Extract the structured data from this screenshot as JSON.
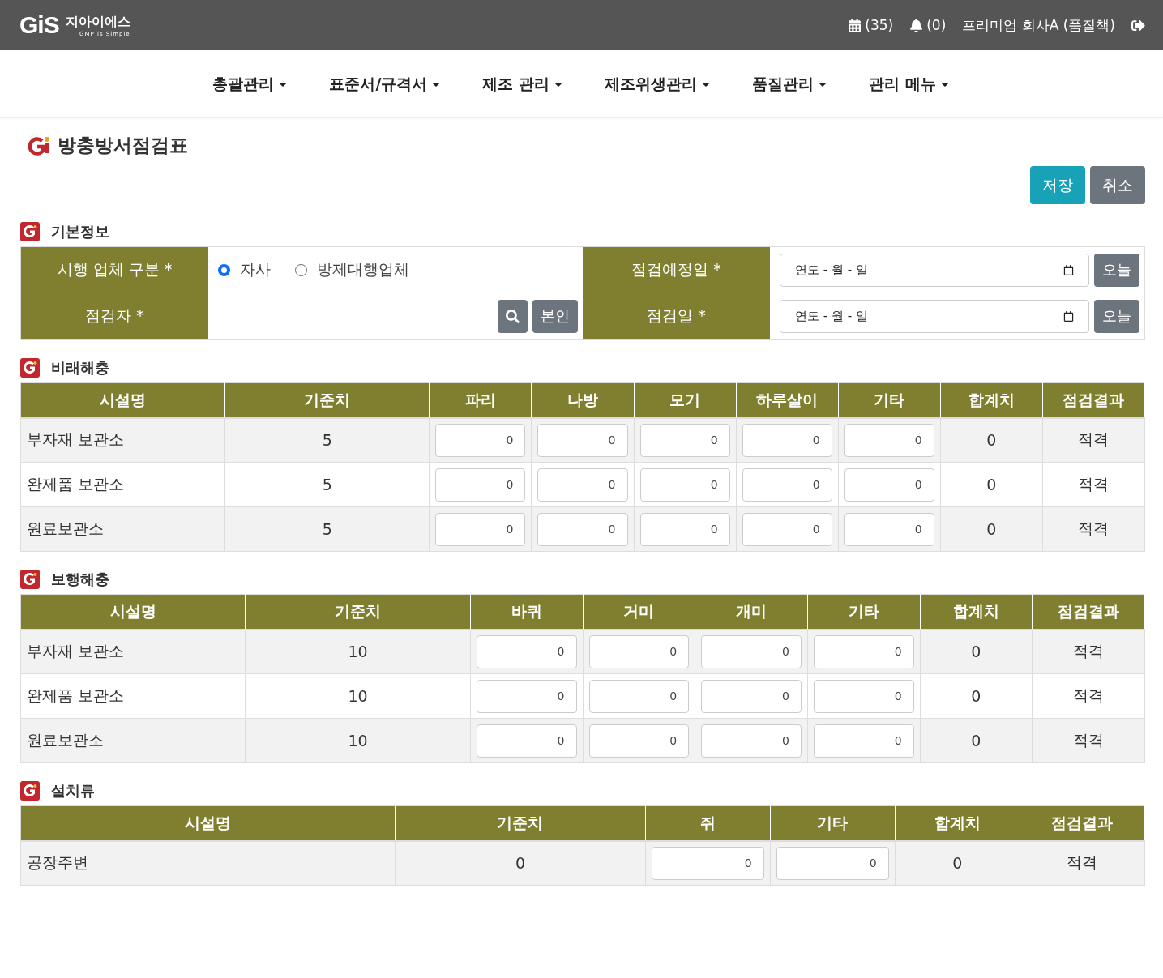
{
  "header": {
    "logo": {
      "mark": "GiS",
      "name": "지아이에스",
      "tagline": "GMP is Simple"
    },
    "calendar_count": "(35)",
    "alerts_count": "(0)",
    "user": "프리미엄 회사A (품질책)"
  },
  "nav": [
    {
      "label": "총괄관리"
    },
    {
      "label": "표준서/규격서"
    },
    {
      "label": "제조 관리"
    },
    {
      "label": "제조위생관리"
    },
    {
      "label": "품질관리"
    },
    {
      "label": "관리 메뉴"
    }
  ],
  "page_title": "방충방서점검표",
  "actions": [
    {
      "label": "저장",
      "kind": "primary"
    },
    {
      "label": "취소",
      "kind": "secondary"
    }
  ],
  "basic_info": {
    "title": "기본정보",
    "vendor_label": "시행 업체 구분 *",
    "vendor_options": [
      {
        "label": "자사",
        "selected": true
      },
      {
        "label": "방제대행업체",
        "selected": false
      }
    ],
    "scheduled_label": "점검예정일 *",
    "scheduled_date": "연도 - 월 - 일",
    "scheduled_today": "오늘",
    "inspector_label": "점검자 *",
    "inspector_self": "본인",
    "date_label": "점검일 *",
    "date_value": "연도 - 월 - 일",
    "date_today": "오늘"
  },
  "sections": [
    {
      "title": "비래해충",
      "columns": [
        "시설명",
        "기준치",
        "파리",
        "나방",
        "모기",
        "하루살이",
        "기타",
        "합계치",
        "점검결과"
      ],
      "rows": [
        {
          "name": "부자재 보관소",
          "standard": "5",
          "values": [
            "0",
            "0",
            "0",
            "0",
            "0"
          ],
          "total": "0",
          "result": "적격"
        },
        {
          "name": "완제품 보관소",
          "standard": "5",
          "values": [
            "0",
            "0",
            "0",
            "0",
            "0"
          ],
          "total": "0",
          "result": "적격"
        },
        {
          "name": "원료보관소",
          "standard": "5",
          "values": [
            "0",
            "0",
            "0",
            "0",
            "0"
          ],
          "total": "0",
          "result": "적격"
        }
      ]
    },
    {
      "title": "보행해충",
      "columns": [
        "시설명",
        "기준치",
        "바퀴",
        "거미",
        "개미",
        "기타",
        "합계치",
        "점검결과"
      ],
      "rows": [
        {
          "name": "부자재 보관소",
          "standard": "10",
          "values": [
            "0",
            "0",
            "0",
            "0"
          ],
          "total": "0",
          "result": "적격"
        },
        {
          "name": "완제품 보관소",
          "standard": "10",
          "values": [
            "0",
            "0",
            "0",
            "0"
          ],
          "total": "0",
          "result": "적격"
        },
        {
          "name": "원료보관소",
          "standard": "10",
          "values": [
            "0",
            "0",
            "0",
            "0"
          ],
          "total": "0",
          "result": "적격"
        }
      ]
    },
    {
      "title": "설치류",
      "columns": [
        "시설명",
        "기준치",
        "쥐",
        "기타",
        "합계치",
        "점검결과"
      ],
      "rows": [
        {
          "name": "공장주변",
          "standard": "0",
          "values": [
            "0",
            "0"
          ],
          "total": "0",
          "result": "적격"
        }
      ]
    }
  ]
}
